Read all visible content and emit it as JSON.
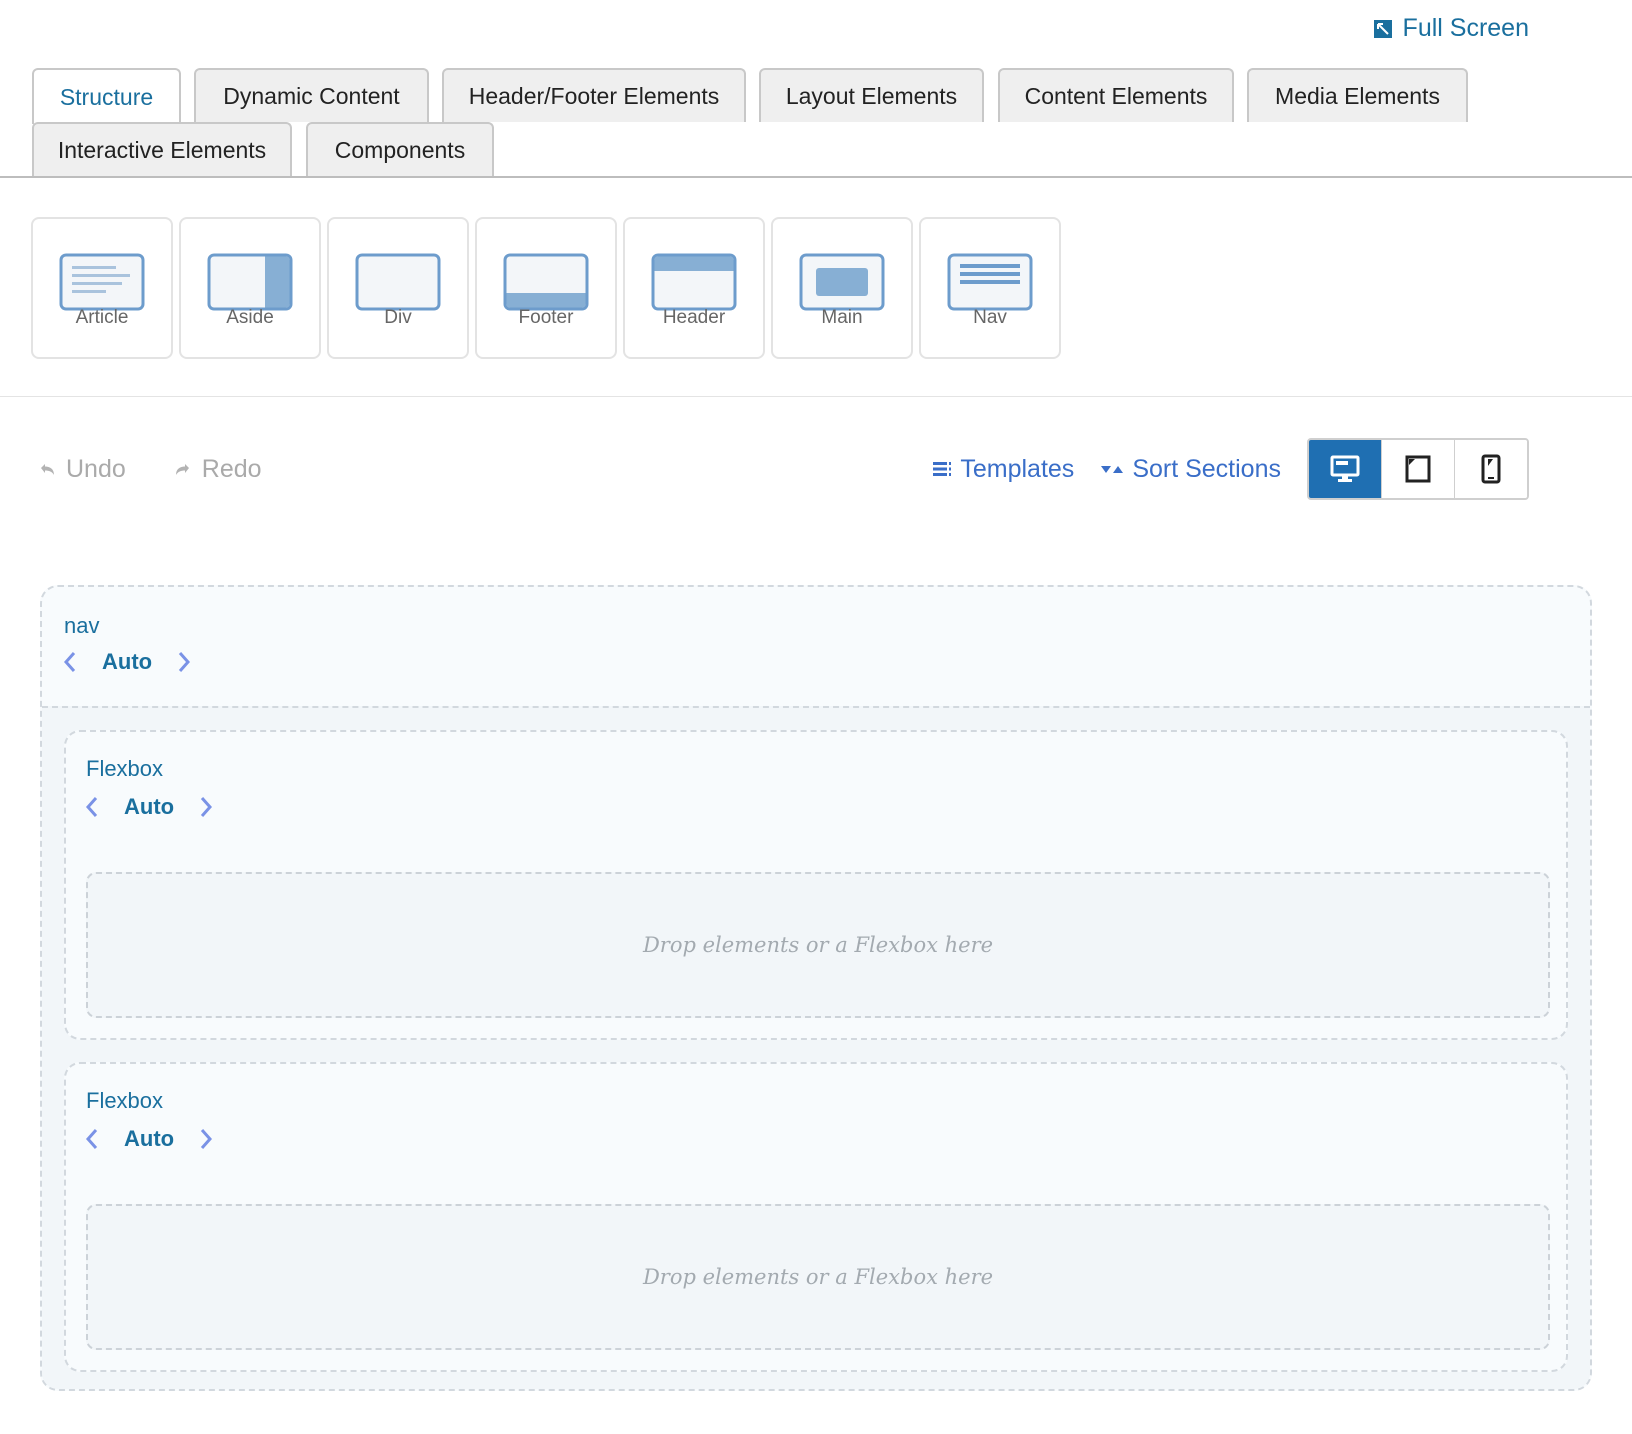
{
  "fullscreen": {
    "label": "Full Screen",
    "icon": "fullscreen-icon"
  },
  "tabs": [
    {
      "label": "Structure",
      "active": true
    },
    {
      "label": "Dynamic Content"
    },
    {
      "label": "Header/Footer Elements"
    },
    {
      "label": "Layout Elements"
    },
    {
      "label": "Content Elements"
    },
    {
      "label": "Media Elements"
    },
    {
      "label": "Interactive Elements"
    },
    {
      "label": "Components"
    }
  ],
  "palette": [
    {
      "label": "Article",
      "icon": "article-icon"
    },
    {
      "label": "Aside",
      "icon": "aside-icon"
    },
    {
      "label": "Div",
      "icon": "div-icon"
    },
    {
      "label": "Footer",
      "icon": "footer-icon"
    },
    {
      "label": "Header",
      "icon": "header-icon"
    },
    {
      "label": "Main",
      "icon": "main-icon"
    },
    {
      "label": "Nav",
      "icon": "nav-icon"
    }
  ],
  "toolbar": {
    "undo": "Undo",
    "redo": "Redo",
    "templates": "Templates",
    "sort_sections": "Sort Sections",
    "devices": [
      {
        "name": "desktop",
        "active": true
      },
      {
        "name": "tablet"
      },
      {
        "name": "mobile"
      }
    ]
  },
  "colors": {
    "accent": "#1a6f9e",
    "link": "#3a6ec8",
    "device_active": "#1f6fb2",
    "icon_fill": "#87afd4"
  },
  "canvas": {
    "section": {
      "name": "nav",
      "width": "Auto"
    },
    "flexboxes": [
      {
        "name": "Flexbox",
        "width": "Auto",
        "placeholder": "Drop elements or a Flexbox here"
      },
      {
        "name": "Flexbox",
        "width": "Auto",
        "placeholder": "Drop elements or a Flexbox here"
      }
    ]
  }
}
